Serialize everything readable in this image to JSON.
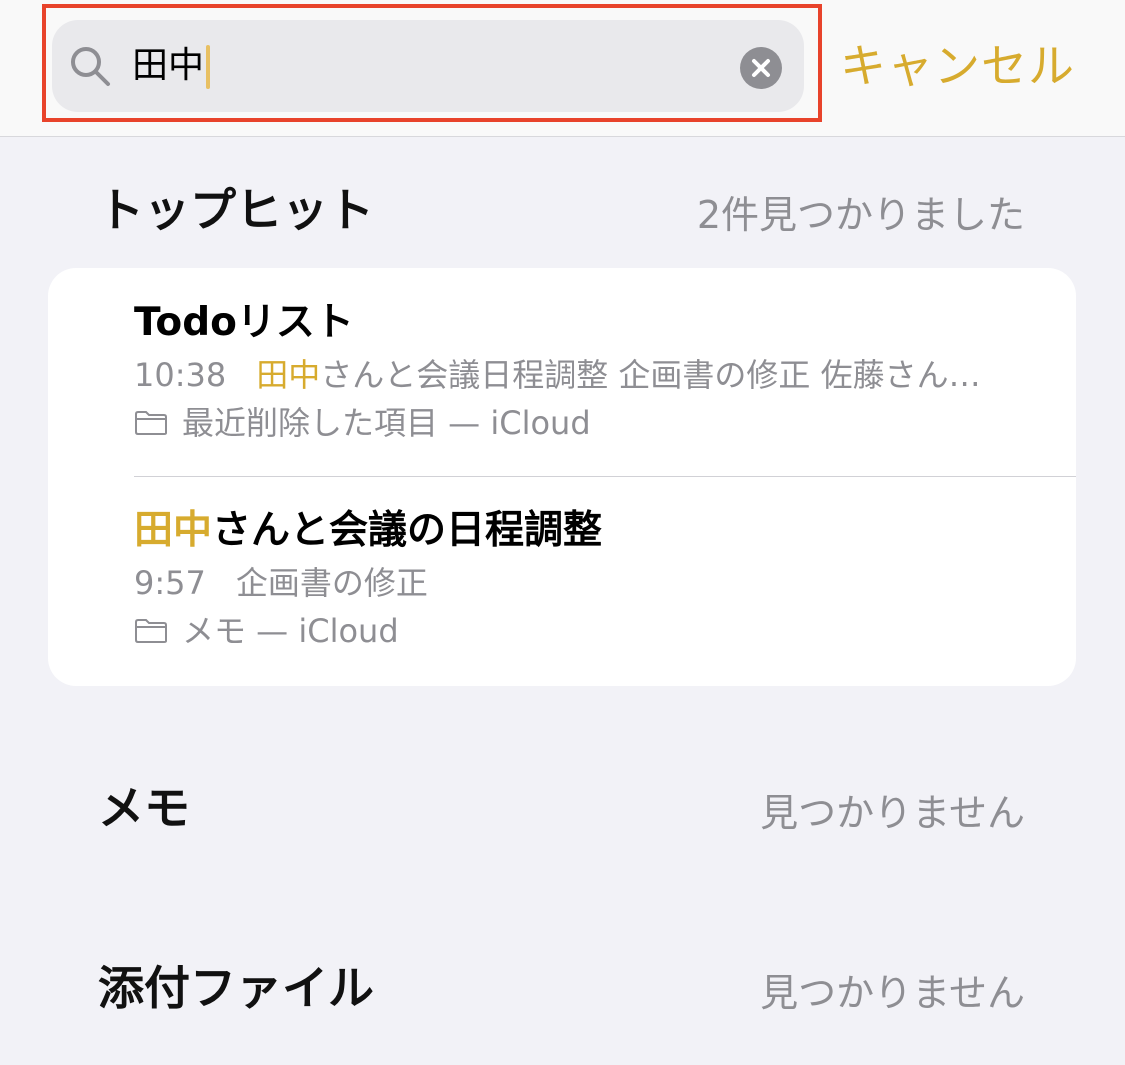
{
  "search": {
    "query": "田中",
    "cancel_label": "キャンセル"
  },
  "top_hits": {
    "header": "トップヒット",
    "count": "2件見つかりました",
    "results": [
      {
        "title": "Todoリスト",
        "time": "10:38",
        "snippet_highlight": "田中",
        "snippet_rest": "さんと会議日程調整 企画書の修正 佐藤さん…",
        "folder": "最近削除した項目 — iCloud"
      },
      {
        "title_highlight": "田中",
        "title_rest": "さんと会議の日程調整",
        "time": "9:57",
        "snippet": "企画書の修正",
        "folder": "メモ — iCloud"
      }
    ]
  },
  "memo_section": {
    "header": "メモ",
    "status": "見つかりません"
  },
  "attachments_section": {
    "header": "添付ファイル",
    "status": "見つかりません"
  },
  "colors": {
    "accent": "#d7ab2e",
    "highlight_border": "#e8432b",
    "secondary_text": "#8e8e93",
    "background": "#f2f2f7"
  },
  "icons": [
    "search-icon",
    "clear-icon",
    "folder-icon"
  ]
}
